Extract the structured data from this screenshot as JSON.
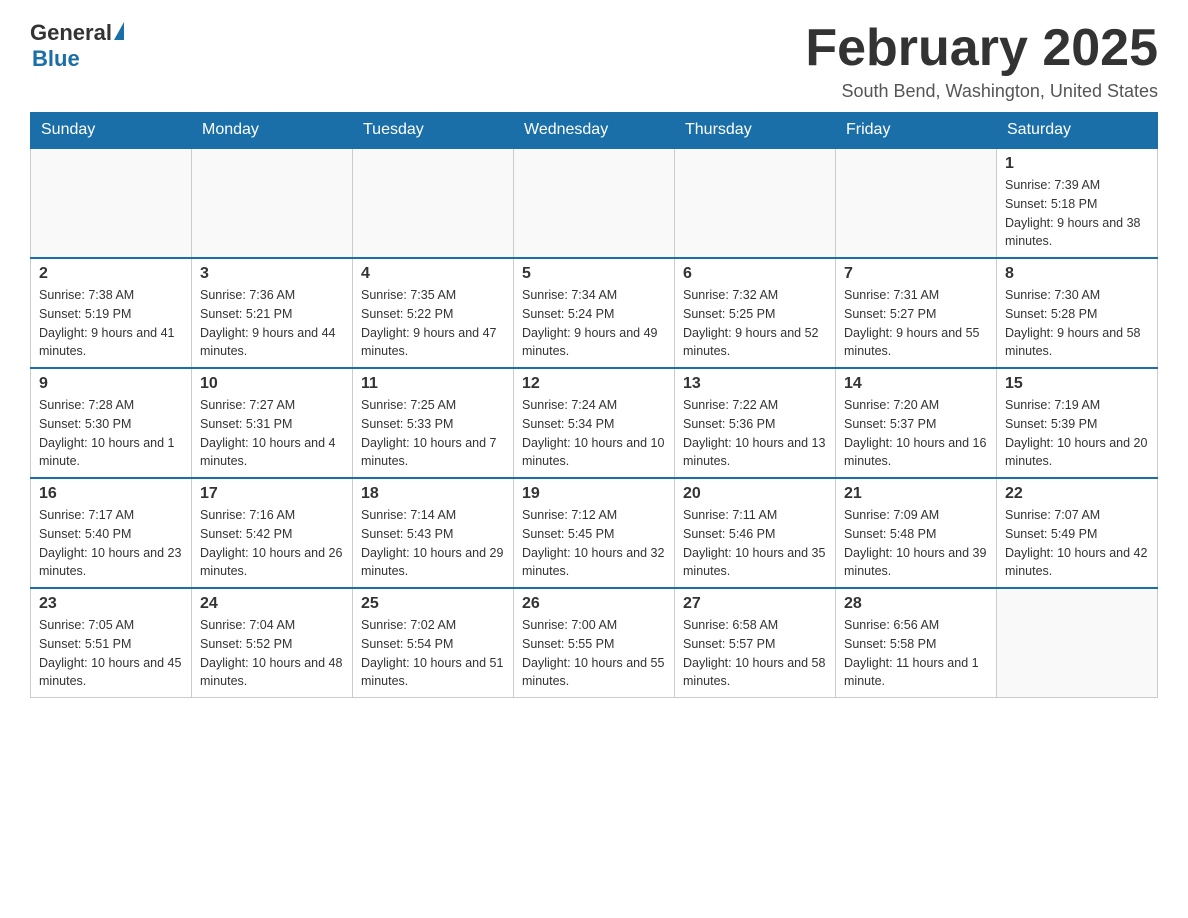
{
  "logo": {
    "general": "General",
    "blue": "Blue"
  },
  "title": "February 2025",
  "location": "South Bend, Washington, United States",
  "days_of_week": [
    "Sunday",
    "Monday",
    "Tuesday",
    "Wednesday",
    "Thursday",
    "Friday",
    "Saturday"
  ],
  "weeks": [
    [
      {
        "day": "",
        "info": ""
      },
      {
        "day": "",
        "info": ""
      },
      {
        "day": "",
        "info": ""
      },
      {
        "day": "",
        "info": ""
      },
      {
        "day": "",
        "info": ""
      },
      {
        "day": "",
        "info": ""
      },
      {
        "day": "1",
        "info": "Sunrise: 7:39 AM\nSunset: 5:18 PM\nDaylight: 9 hours and 38 minutes."
      }
    ],
    [
      {
        "day": "2",
        "info": "Sunrise: 7:38 AM\nSunset: 5:19 PM\nDaylight: 9 hours and 41 minutes."
      },
      {
        "day": "3",
        "info": "Sunrise: 7:36 AM\nSunset: 5:21 PM\nDaylight: 9 hours and 44 minutes."
      },
      {
        "day": "4",
        "info": "Sunrise: 7:35 AM\nSunset: 5:22 PM\nDaylight: 9 hours and 47 minutes."
      },
      {
        "day": "5",
        "info": "Sunrise: 7:34 AM\nSunset: 5:24 PM\nDaylight: 9 hours and 49 minutes."
      },
      {
        "day": "6",
        "info": "Sunrise: 7:32 AM\nSunset: 5:25 PM\nDaylight: 9 hours and 52 minutes."
      },
      {
        "day": "7",
        "info": "Sunrise: 7:31 AM\nSunset: 5:27 PM\nDaylight: 9 hours and 55 minutes."
      },
      {
        "day": "8",
        "info": "Sunrise: 7:30 AM\nSunset: 5:28 PM\nDaylight: 9 hours and 58 minutes."
      }
    ],
    [
      {
        "day": "9",
        "info": "Sunrise: 7:28 AM\nSunset: 5:30 PM\nDaylight: 10 hours and 1 minute."
      },
      {
        "day": "10",
        "info": "Sunrise: 7:27 AM\nSunset: 5:31 PM\nDaylight: 10 hours and 4 minutes."
      },
      {
        "day": "11",
        "info": "Sunrise: 7:25 AM\nSunset: 5:33 PM\nDaylight: 10 hours and 7 minutes."
      },
      {
        "day": "12",
        "info": "Sunrise: 7:24 AM\nSunset: 5:34 PM\nDaylight: 10 hours and 10 minutes."
      },
      {
        "day": "13",
        "info": "Sunrise: 7:22 AM\nSunset: 5:36 PM\nDaylight: 10 hours and 13 minutes."
      },
      {
        "day": "14",
        "info": "Sunrise: 7:20 AM\nSunset: 5:37 PM\nDaylight: 10 hours and 16 minutes."
      },
      {
        "day": "15",
        "info": "Sunrise: 7:19 AM\nSunset: 5:39 PM\nDaylight: 10 hours and 20 minutes."
      }
    ],
    [
      {
        "day": "16",
        "info": "Sunrise: 7:17 AM\nSunset: 5:40 PM\nDaylight: 10 hours and 23 minutes."
      },
      {
        "day": "17",
        "info": "Sunrise: 7:16 AM\nSunset: 5:42 PM\nDaylight: 10 hours and 26 minutes."
      },
      {
        "day": "18",
        "info": "Sunrise: 7:14 AM\nSunset: 5:43 PM\nDaylight: 10 hours and 29 minutes."
      },
      {
        "day": "19",
        "info": "Sunrise: 7:12 AM\nSunset: 5:45 PM\nDaylight: 10 hours and 32 minutes."
      },
      {
        "day": "20",
        "info": "Sunrise: 7:11 AM\nSunset: 5:46 PM\nDaylight: 10 hours and 35 minutes."
      },
      {
        "day": "21",
        "info": "Sunrise: 7:09 AM\nSunset: 5:48 PM\nDaylight: 10 hours and 39 minutes."
      },
      {
        "day": "22",
        "info": "Sunrise: 7:07 AM\nSunset: 5:49 PM\nDaylight: 10 hours and 42 minutes."
      }
    ],
    [
      {
        "day": "23",
        "info": "Sunrise: 7:05 AM\nSunset: 5:51 PM\nDaylight: 10 hours and 45 minutes."
      },
      {
        "day": "24",
        "info": "Sunrise: 7:04 AM\nSunset: 5:52 PM\nDaylight: 10 hours and 48 minutes."
      },
      {
        "day": "25",
        "info": "Sunrise: 7:02 AM\nSunset: 5:54 PM\nDaylight: 10 hours and 51 minutes."
      },
      {
        "day": "26",
        "info": "Sunrise: 7:00 AM\nSunset: 5:55 PM\nDaylight: 10 hours and 55 minutes."
      },
      {
        "day": "27",
        "info": "Sunrise: 6:58 AM\nSunset: 5:57 PM\nDaylight: 10 hours and 58 minutes."
      },
      {
        "day": "28",
        "info": "Sunrise: 6:56 AM\nSunset: 5:58 PM\nDaylight: 11 hours and 1 minute."
      },
      {
        "day": "",
        "info": ""
      }
    ]
  ]
}
